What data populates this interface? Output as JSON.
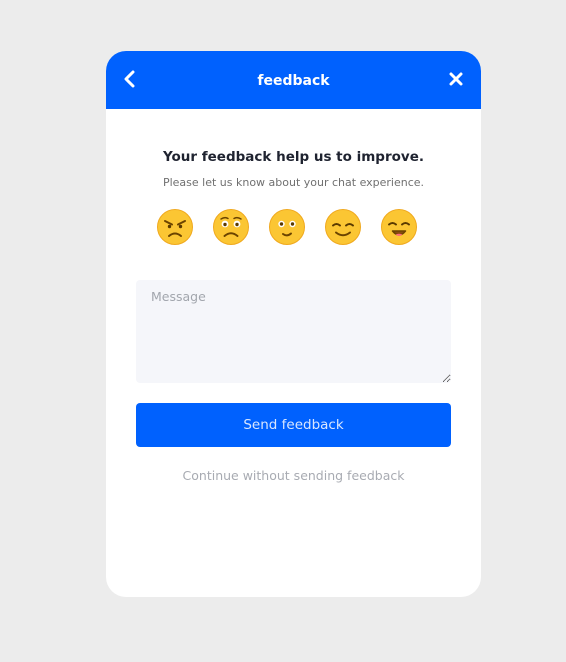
{
  "header": {
    "title": "feedback",
    "back_icon": "chevron-left-icon",
    "close_icon": "close-icon",
    "color": "#0061fe"
  },
  "content": {
    "heading": "Your feedback help us to improve.",
    "subheading": "Please let us know about your chat experience."
  },
  "ratings": [
    {
      "icon": "angry-face-icon"
    },
    {
      "icon": "sad-face-icon"
    },
    {
      "icon": "neutral-face-icon"
    },
    {
      "icon": "smiling-face-icon"
    },
    {
      "icon": "happy-face-icon"
    }
  ],
  "message": {
    "placeholder": "Message",
    "value": ""
  },
  "actions": {
    "send_label": "Send feedback",
    "skip_label": "Continue without sending feedback"
  }
}
